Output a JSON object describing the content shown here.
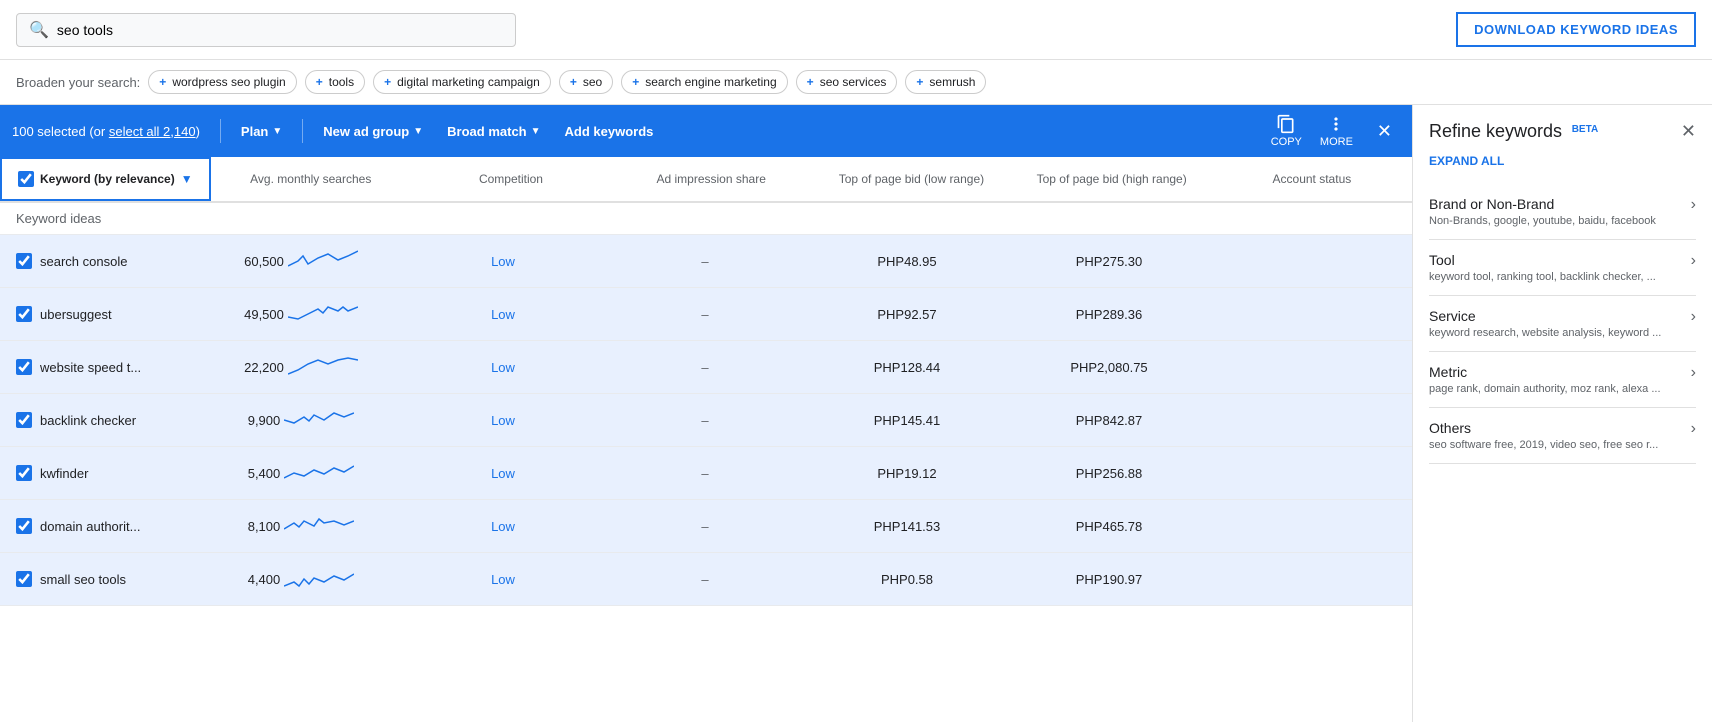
{
  "search": {
    "value": "seo tools",
    "placeholder": "seo tools",
    "search_icon": "🔍"
  },
  "download_btn": "DOWNLOAD KEYWORD IDEAS",
  "broaden": {
    "label": "Broaden your search:",
    "chips": [
      "wordpress seo plugin",
      "tools",
      "digital marketing campaign",
      "seo",
      "search engine marketing",
      "seo services",
      "semrush"
    ]
  },
  "action_bar": {
    "selected_text": "100 selected (or ",
    "select_all_text": "select all 2,140",
    "select_all_suffix": ")",
    "plan_label": "Plan",
    "new_ad_group_label": "New ad group",
    "broad_match_label": "Broad match",
    "add_keywords_label": "Add keywords",
    "copy_label": "COPY",
    "more_label": "MORE"
  },
  "table": {
    "header": {
      "keyword_col": "Keyword (by relevance)",
      "avg_searches_col": "Avg. monthly searches",
      "competition_col": "Competition",
      "ad_impression_col": "Ad impression share",
      "top_bid_low_col": "Top of page bid (low range)",
      "top_bid_high_col": "Top of page bid (high range)",
      "account_status_col": "Account status"
    },
    "keyword_ideas_label": "Keyword ideas",
    "rows": [
      {
        "keyword": "search console",
        "avg_searches": "60,500",
        "competition": "Low",
        "ad_impression": "–",
        "top_bid_low": "PHP48.95",
        "top_bid_high": "PHP275.30",
        "account_status": ""
      },
      {
        "keyword": "ubersuggest",
        "avg_searches": "49,500",
        "competition": "Low",
        "ad_impression": "–",
        "top_bid_low": "PHP92.57",
        "top_bid_high": "PHP289.36",
        "account_status": ""
      },
      {
        "keyword": "website speed t...",
        "avg_searches": "22,200",
        "competition": "Low",
        "ad_impression": "–",
        "top_bid_low": "PHP128.44",
        "top_bid_high": "PHP2,080.75",
        "account_status": ""
      },
      {
        "keyword": "backlink checker",
        "avg_searches": "9,900",
        "competition": "Low",
        "ad_impression": "–",
        "top_bid_low": "PHP145.41",
        "top_bid_high": "PHP842.87",
        "account_status": ""
      },
      {
        "keyword": "kwfinder",
        "avg_searches": "5,400",
        "competition": "Low",
        "ad_impression": "–",
        "top_bid_low": "PHP19.12",
        "top_bid_high": "PHP256.88",
        "account_status": ""
      },
      {
        "keyword": "domain authorit...",
        "avg_searches": "8,100",
        "competition": "Low",
        "ad_impression": "–",
        "top_bid_low": "PHP141.53",
        "top_bid_high": "PHP465.78",
        "account_status": ""
      },
      {
        "keyword": "small seo tools",
        "avg_searches": "4,400",
        "competition": "Low",
        "ad_impression": "–",
        "top_bid_low": "PHP0.58",
        "top_bid_high": "PHP190.97",
        "account_status": ""
      }
    ]
  },
  "right_panel": {
    "title": "Refine keywords",
    "beta": "BETA",
    "expand_all": "EXPAND ALL",
    "categories": [
      {
        "title": "Brand or Non-Brand",
        "subtitle": "Non-Brands, google, youtube, baidu, facebook"
      },
      {
        "title": "Tool",
        "subtitle": "keyword tool, ranking tool, backlink checker, ..."
      },
      {
        "title": "Service",
        "subtitle": "keyword research, website analysis, keyword ..."
      },
      {
        "title": "Metric",
        "subtitle": "page rank, domain authority, moz rank, alexa ..."
      },
      {
        "title": "Others",
        "subtitle": "seo software free, 2019, video seo, free seo r..."
      }
    ]
  },
  "sparklines": [
    "M0,20 L10,15 L15,10 L20,18 L30,12 L40,8 L50,14 L60,10 L70,5",
    "M0,18 L10,20 L20,15 L30,10 L35,14 L40,8 L50,12 L55,8 L60,12 L70,8",
    "M0,22 L10,18 L20,12 L30,8 L40,12 L50,8 L60,6 L70,8",
    "M0,15 L10,18 L20,12 L25,16 L30,10 L40,15 L50,8 L60,12 L70,8",
    "M0,20 L10,15 L20,18 L30,12 L40,16 L50,10 L60,14 L70,8",
    "M0,18 L10,12 L15,16 L20,10 L30,15 L35,8 L40,12 L50,10 L60,14 L70,10",
    "M0,22 L10,18 L15,22 L20,15 L25,20 L30,14 L40,18 L50,12 L60,16 L70,10"
  ]
}
